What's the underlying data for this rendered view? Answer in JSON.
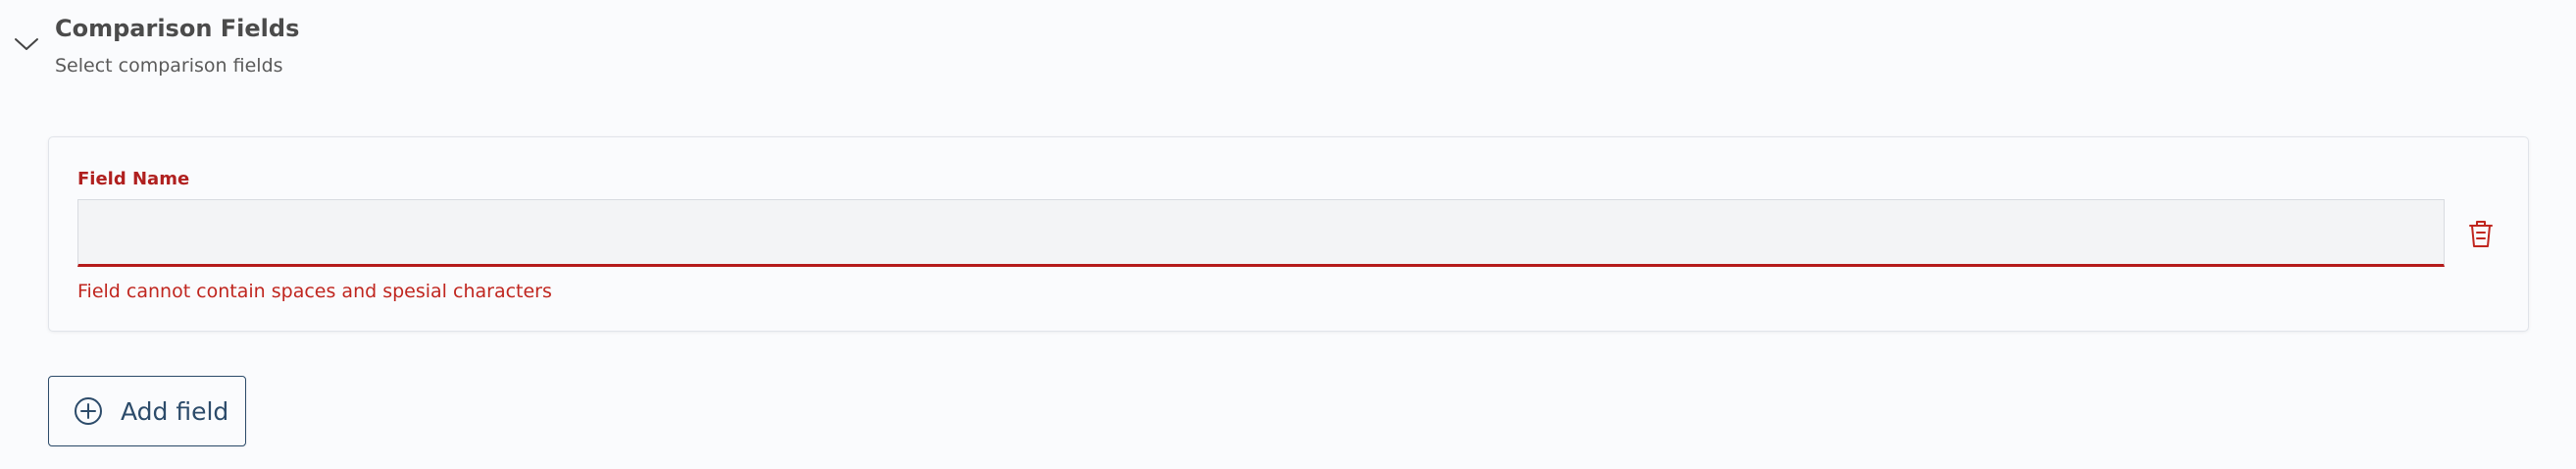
{
  "section": {
    "title": "Comparison Fields",
    "subtitle": "Select comparison fields",
    "expand_icon": "chevron-down-icon"
  },
  "field": {
    "label": "Field Name",
    "value": "",
    "placeholder": "",
    "error": "Field cannot contain spaces and spesial characters",
    "delete_icon": "trash-icon"
  },
  "add_button": {
    "label": "Add field",
    "icon": "plus-circle-icon"
  },
  "colors": {
    "error": "#b51b1b",
    "primary": "#2c4b6a",
    "background": "#fafbfd",
    "input_background": "#f3f4f6"
  }
}
